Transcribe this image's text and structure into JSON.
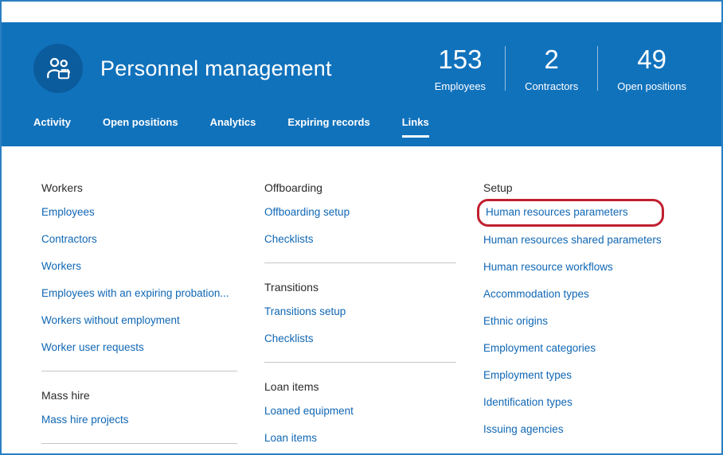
{
  "header": {
    "title": "Personnel management",
    "icon": "people-group-icon",
    "stats": [
      {
        "value": "153",
        "label": "Employees"
      },
      {
        "value": "2",
        "label": "Contractors"
      },
      {
        "value": "49",
        "label": "Open positions"
      }
    ],
    "tabs": [
      {
        "label": "Activity",
        "active": false
      },
      {
        "label": "Open positions",
        "active": false
      },
      {
        "label": "Analytics",
        "active": false
      },
      {
        "label": "Expiring records",
        "active": false
      },
      {
        "label": "Links",
        "active": true
      }
    ]
  },
  "columns": [
    {
      "sections": [
        {
          "title": "Workers",
          "links": [
            "Employees",
            "Contractors",
            "Workers",
            "Employees with an expiring probation...",
            "Workers without employment",
            "Worker user requests"
          ]
        },
        {
          "title": "Mass hire",
          "links": [
            "Mass hire projects"
          ]
        }
      ]
    },
    {
      "sections": [
        {
          "title": "Offboarding",
          "links": [
            "Offboarding setup",
            "Checklists"
          ]
        },
        {
          "title": "Transitions",
          "links": [
            "Transitions setup",
            "Checklists"
          ]
        },
        {
          "title": "Loan items",
          "links": [
            "Loaned equipment",
            "Loan items"
          ]
        }
      ]
    },
    {
      "sections": [
        {
          "title": "Setup",
          "highlighted_link": "Human resources parameters",
          "links": [
            "Human resources parameters",
            "Human resources shared parameters",
            "Human resource workflows",
            "Accommodation types",
            "Ethnic origins",
            "Employment categories",
            "Employment types",
            "Identification types",
            "Issuing agencies"
          ]
        }
      ]
    }
  ],
  "colors": {
    "header_blue": "#1172bc",
    "icon_circle_blue": "#0b5c9d",
    "link_blue": "#1067b4",
    "highlight_red": "#c0202f",
    "window_border_blue": "#2a7fc2"
  }
}
